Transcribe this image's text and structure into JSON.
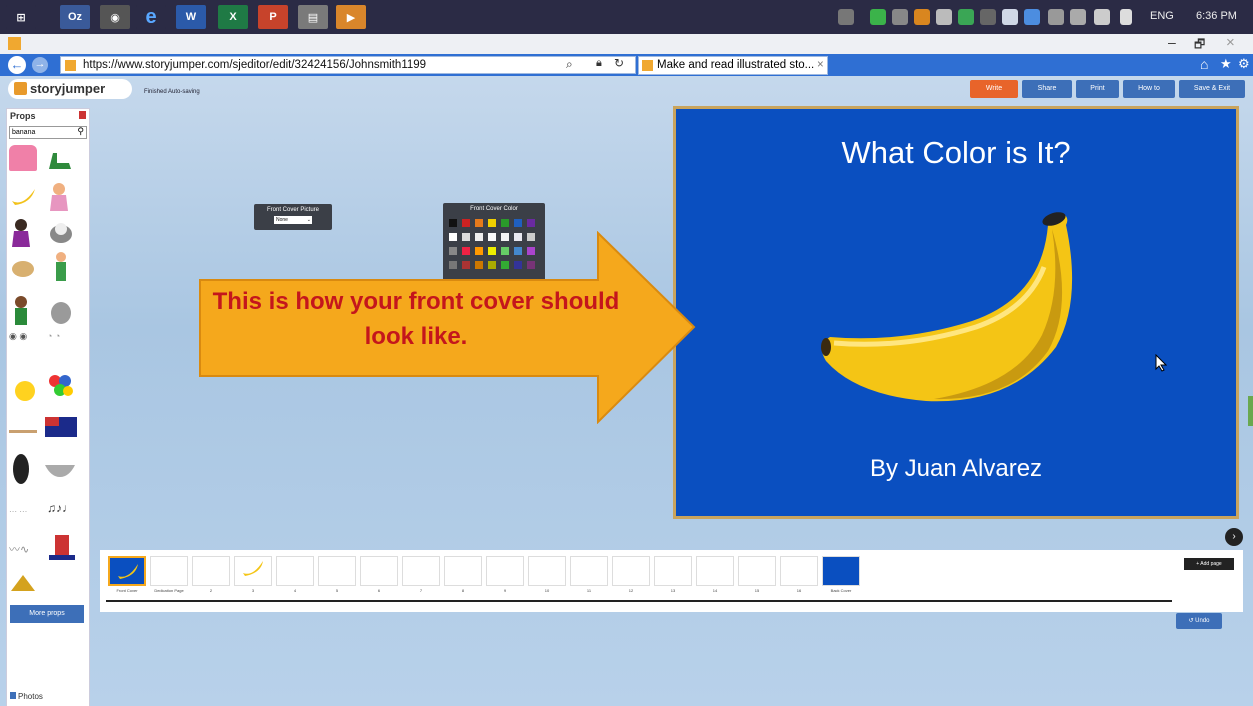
{
  "taskbar": {
    "lang": "ENG",
    "time": "6:36 PM"
  },
  "browser": {
    "url": "https://www.storyjumper.com/sjeditor/edit/32424156/Johnsmith1199",
    "tab_title": "Make and read illustrated sto...",
    "tab_close": "×",
    "window_min": "–",
    "window_max": "🗗",
    "window_close": "×"
  },
  "app": {
    "logo": "storyjumper",
    "autosave_text": "Finished Auto-saving",
    "toolbar": {
      "write": "Write",
      "share": "Share",
      "print": "Print",
      "howto": "How to",
      "save_exit": "Save & Exit"
    },
    "props_panel": {
      "title": "Props",
      "search_value": "banana",
      "more_props": "More props",
      "photos": "Photos"
    },
    "front_cover_picture": {
      "title": "Front Cover Picture",
      "select_value": "None"
    },
    "front_cover_color": {
      "title": "Front Cover Color"
    },
    "cover": {
      "title": "What Color is It?",
      "author": "By Juan Alvarez"
    },
    "callout": "This is how your front cover should look like.",
    "add_page": "+ Add page",
    "undo": "Undo",
    "thumbnails": [
      {
        "label": "Front Cover"
      },
      {
        "label": "Dedication Page"
      },
      {
        "label": "2"
      },
      {
        "label": "3"
      },
      {
        "label": "4"
      },
      {
        "label": "5"
      },
      {
        "label": "6"
      },
      {
        "label": "7"
      },
      {
        "label": "8"
      },
      {
        "label": "9"
      },
      {
        "label": "10"
      },
      {
        "label": "11"
      },
      {
        "label": "12"
      },
      {
        "label": "13"
      },
      {
        "label": "14"
      },
      {
        "label": "15"
      },
      {
        "label": "16"
      },
      {
        "label": "Back Cover"
      }
    ]
  },
  "colors": {
    "cover_blue": "#0a4fc0",
    "arrow_orange": "#f5a81c",
    "callout_red": "#c4161c",
    "write_orange": "#e8642a",
    "button_blue": "#3d6fb8"
  }
}
